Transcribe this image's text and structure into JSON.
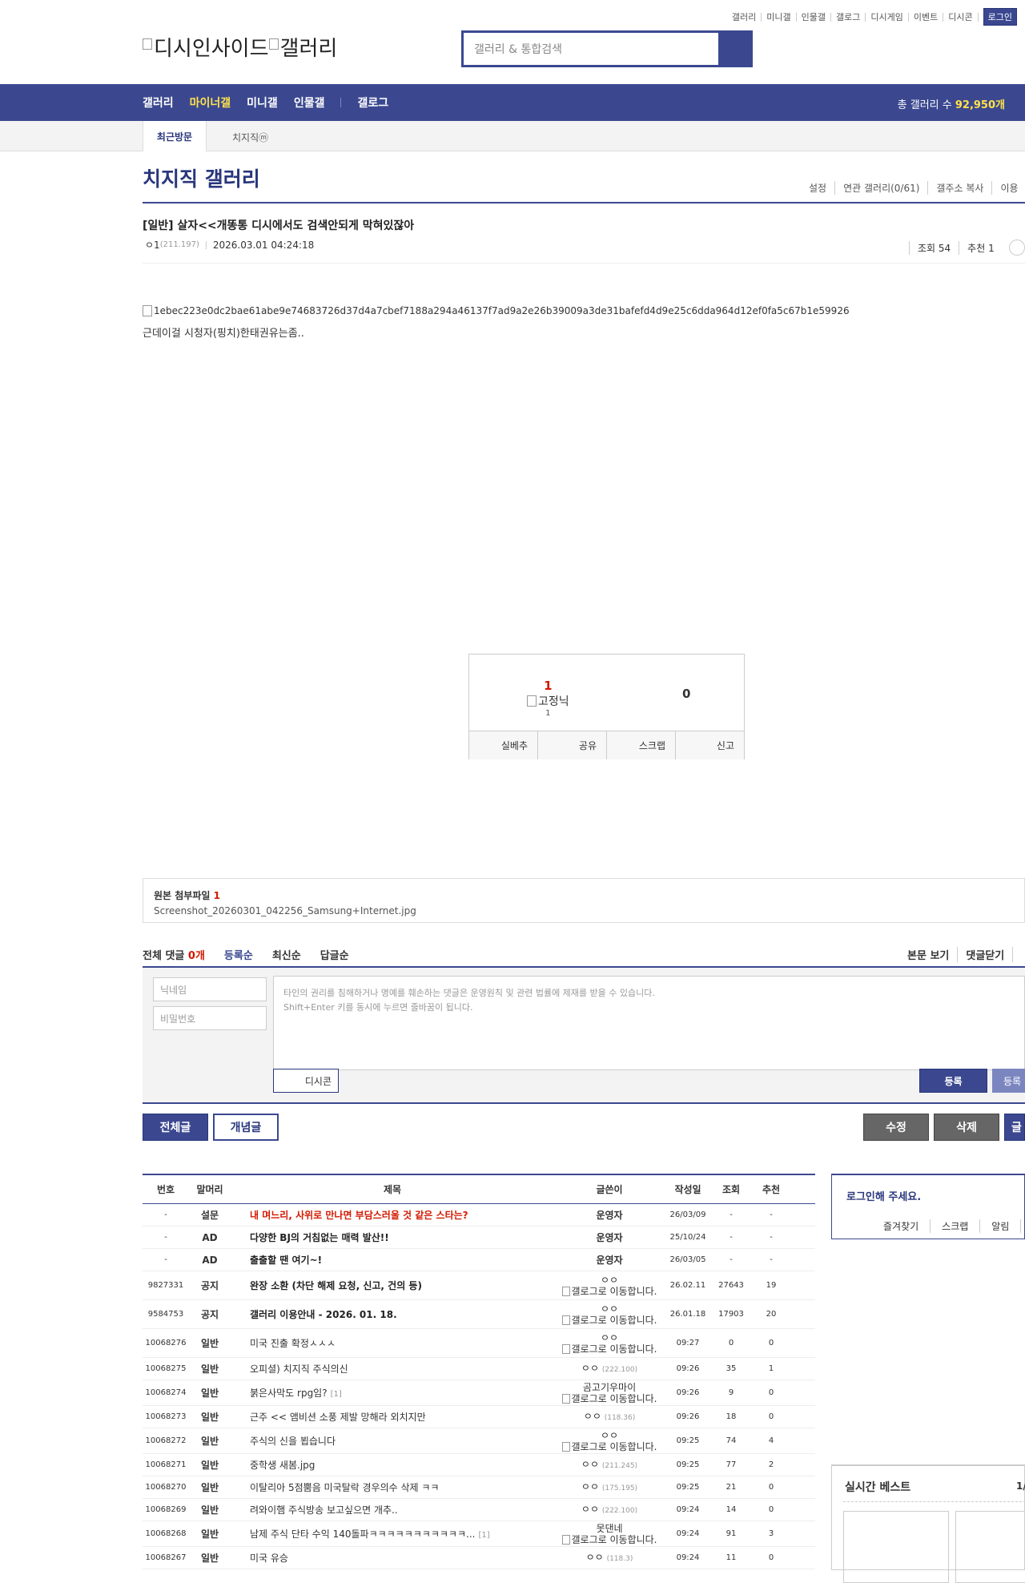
{
  "util": [
    "갤러리",
    "미니갤",
    "인물갤",
    "갤로그",
    "디시게임",
    "이벤트",
    "디시콘"
  ],
  "login_label": "로그인",
  "logo": {
    "part1": "디시인사이드",
    "part2": "갤러리"
  },
  "search": {
    "placeholder": "갤러리 & 통합검색"
  },
  "gnb": {
    "items": [
      "갤러리",
      "마이너갤",
      "미니갤",
      "인물갤",
      "갤로그"
    ],
    "total_label": "총 갤러리 수 ",
    "total_count": "92,950개"
  },
  "visit": {
    "head": "최근방문",
    "item": "치지직ⓜ"
  },
  "gallery": {
    "title": "치지직 갤러리",
    "menu": [
      "설정",
      "연관 갤러리(0/61)",
      "갤주소 복사",
      "이용"
    ]
  },
  "post": {
    "title": "[일반] 살자<<개똥통 디시에서도 검색안되게 막혀있잖아",
    "writer": "ㅇ1",
    "ip": "(211.197)",
    "date": "2026.03.01 04:24:18",
    "views": "조회 54",
    "recs": "추천 1",
    "image_alt": "1ebec223e0dc2bae61abe9e74683726d37d4a7cbef7188a294a46137f7ad9a2e26b39009a3de31bafefd4d9e25c6dda964d12ef0fa5c67b1e59926",
    "body": "근데이걸 시청자(핑치)한태권유는좀.."
  },
  "recommend": {
    "up": "1",
    "fix_alt": "고정닉",
    "fix_count": "1",
    "down": "0",
    "buttons": [
      "실베추",
      "공유",
      "스크랩",
      "신고"
    ]
  },
  "attach": {
    "label": "원본 첨부파일 ",
    "count": "1",
    "file": "Screenshot_20260301_042256_Samsung+Internet.jpg"
  },
  "comments": {
    "total_label": "전체 댓글 ",
    "total_count": "0개",
    "sorts": [
      "등록순",
      "최신순",
      "답글순"
    ],
    "right": [
      "본문 보기",
      "댓글닫기"
    ],
    "nick_placeholder": "닉네임",
    "pw_placeholder": "비밀번호",
    "textarea_line1": "타인의 권리를 침해하거나 명예를 훼손하는 댓글은 운영원칙 및 관련 법률에 제재를 받을 수 있습니다.",
    "textarea_line2": "Shift+Enter 키를 동시에 누르면 줄바꿈이 됩니다.",
    "dccon": "디시콘",
    "submit": "등록",
    "submit2": "등록"
  },
  "actions": {
    "all": "전체글",
    "concept": "개념글",
    "edit": "수정",
    "delete": "삭제",
    "write": "글"
  },
  "list": {
    "headers": [
      "번호",
      "말머리",
      "제목",
      "글쓴이",
      "작성일",
      "조회",
      "추천"
    ],
    "rows": [
      {
        "no": "-",
        "head": "설문",
        "title": "내 며느리, 사위로 만나면 부담스러울 것 같은 스타는?",
        "writer": "운영자",
        "date": "26/03/09",
        "view": "-",
        "rec": "-"
      },
      {
        "no": "-",
        "head": "AD",
        "title": "다양한 BJ의 거침없는 매력 발산!!",
        "writer": "운영자",
        "date": "25/10/24",
        "view": "-",
        "rec": "-"
      },
      {
        "no": "-",
        "head": "AD",
        "title": "출출할 땐 여기~!",
        "writer": "운영자",
        "date": "26/03/05",
        "view": "-",
        "rec": "-"
      },
      {
        "no": "9827331",
        "head": "공지",
        "title": "완장 소환 (차단 해제 요청, 신고, 건의 등)",
        "writer": "ㅇㅇ",
        "gallog": "갤로그로 이동합니다.",
        "date": "26.02.11",
        "view": "27643",
        "rec": "19"
      },
      {
        "no": "9584753",
        "head": "공지",
        "title": "갤러리 이용안내 - 2026. 01. 18.",
        "writer": "ㅇㅇ",
        "gallog": "갤로그로 이동합니다.",
        "date": "26.01.18",
        "view": "17903",
        "rec": "20"
      },
      {
        "no": "10068276",
        "head": "일반",
        "title": "미국 진출 확정ㅅㅅㅅ",
        "writer": "ㅇㅇ",
        "gallog": "갤로그로 이동합니다.",
        "date": "09:27",
        "view": "0",
        "rec": "0"
      },
      {
        "no": "10068275",
        "head": "일반",
        "title": "오피셜) 치지직 주식의신",
        "writer": "ㅇㅇ",
        "ip": "(222.100)",
        "date": "09:26",
        "view": "35",
        "rec": "1"
      },
      {
        "no": "10068274",
        "head": "일반",
        "title": "붉은사막도 rpg임?",
        "reply": "[1]",
        "writer": "곰고기우마이",
        "gallog": "갤로그로 이동합니다.",
        "date": "09:26",
        "view": "9",
        "rec": "0"
      },
      {
        "no": "10068273",
        "head": "일반",
        "title": "근주 << 앰비션 소풍 제발 망해라 외치지만",
        "writer": "ㅇㅇ",
        "ip": "(118.36)",
        "date": "09:26",
        "view": "18",
        "rec": "0"
      },
      {
        "no": "10068272",
        "head": "일반",
        "title": "주식의 신을 뵙습니다",
        "writer": "ㅇㅇ",
        "gallog": "갤로그로 이동합니다.",
        "date": "09:25",
        "view": "74",
        "rec": "4"
      },
      {
        "no": "10068271",
        "head": "일반",
        "title": "중학생 새봄.jpg",
        "writer": "ㅇㅇ",
        "ip": "(211.245)",
        "date": "09:25",
        "view": "77",
        "rec": "2"
      },
      {
        "no": "10068270",
        "head": "일반",
        "title": "이탈리아 5점뿜음 미국탈락 경우의수 삭제 ㅋㅋ",
        "writer": "ㅇㅇ",
        "ip": "(175.195)",
        "date": "09:25",
        "view": "21",
        "rec": "0"
      },
      {
        "no": "10068269",
        "head": "일반",
        "title": "려와이햄 주식방송 보고싶으면 개추..",
        "writer": "ㅇㅇ",
        "ip": "(222.100)",
        "date": "09:24",
        "view": "14",
        "rec": "0"
      },
      {
        "no": "10068268",
        "head": "일반",
        "title": "남제 주식 단타 수익 140돌파ㅋㅋㅋㅋㅋㅋㅋㅋㅋㅋㅋ...",
        "reply": "[1]",
        "writer": "못댄네",
        "gallog": "갤로그로 이동합니다.",
        "date": "09:24",
        "view": "91",
        "rec": "3"
      },
      {
        "no": "10068267",
        "head": "일반",
        "title": "미국 유승",
        "writer": "ㅇㅇ",
        "ip": "(118.3)",
        "date": "09:24",
        "view": "11",
        "rec": "0"
      }
    ]
  },
  "sidebar": {
    "login_title": "로그인해 주세요.",
    "login_links": [
      "즐겨찾기",
      "스크랩",
      "알림"
    ],
    "best_title": "실시간 베스트",
    "best_page": "1/"
  },
  "colors": {
    "primary": "#3b4890",
    "dark": "#29367c",
    "accent_yellow": "#ffe249",
    "red": "#d31900"
  }
}
